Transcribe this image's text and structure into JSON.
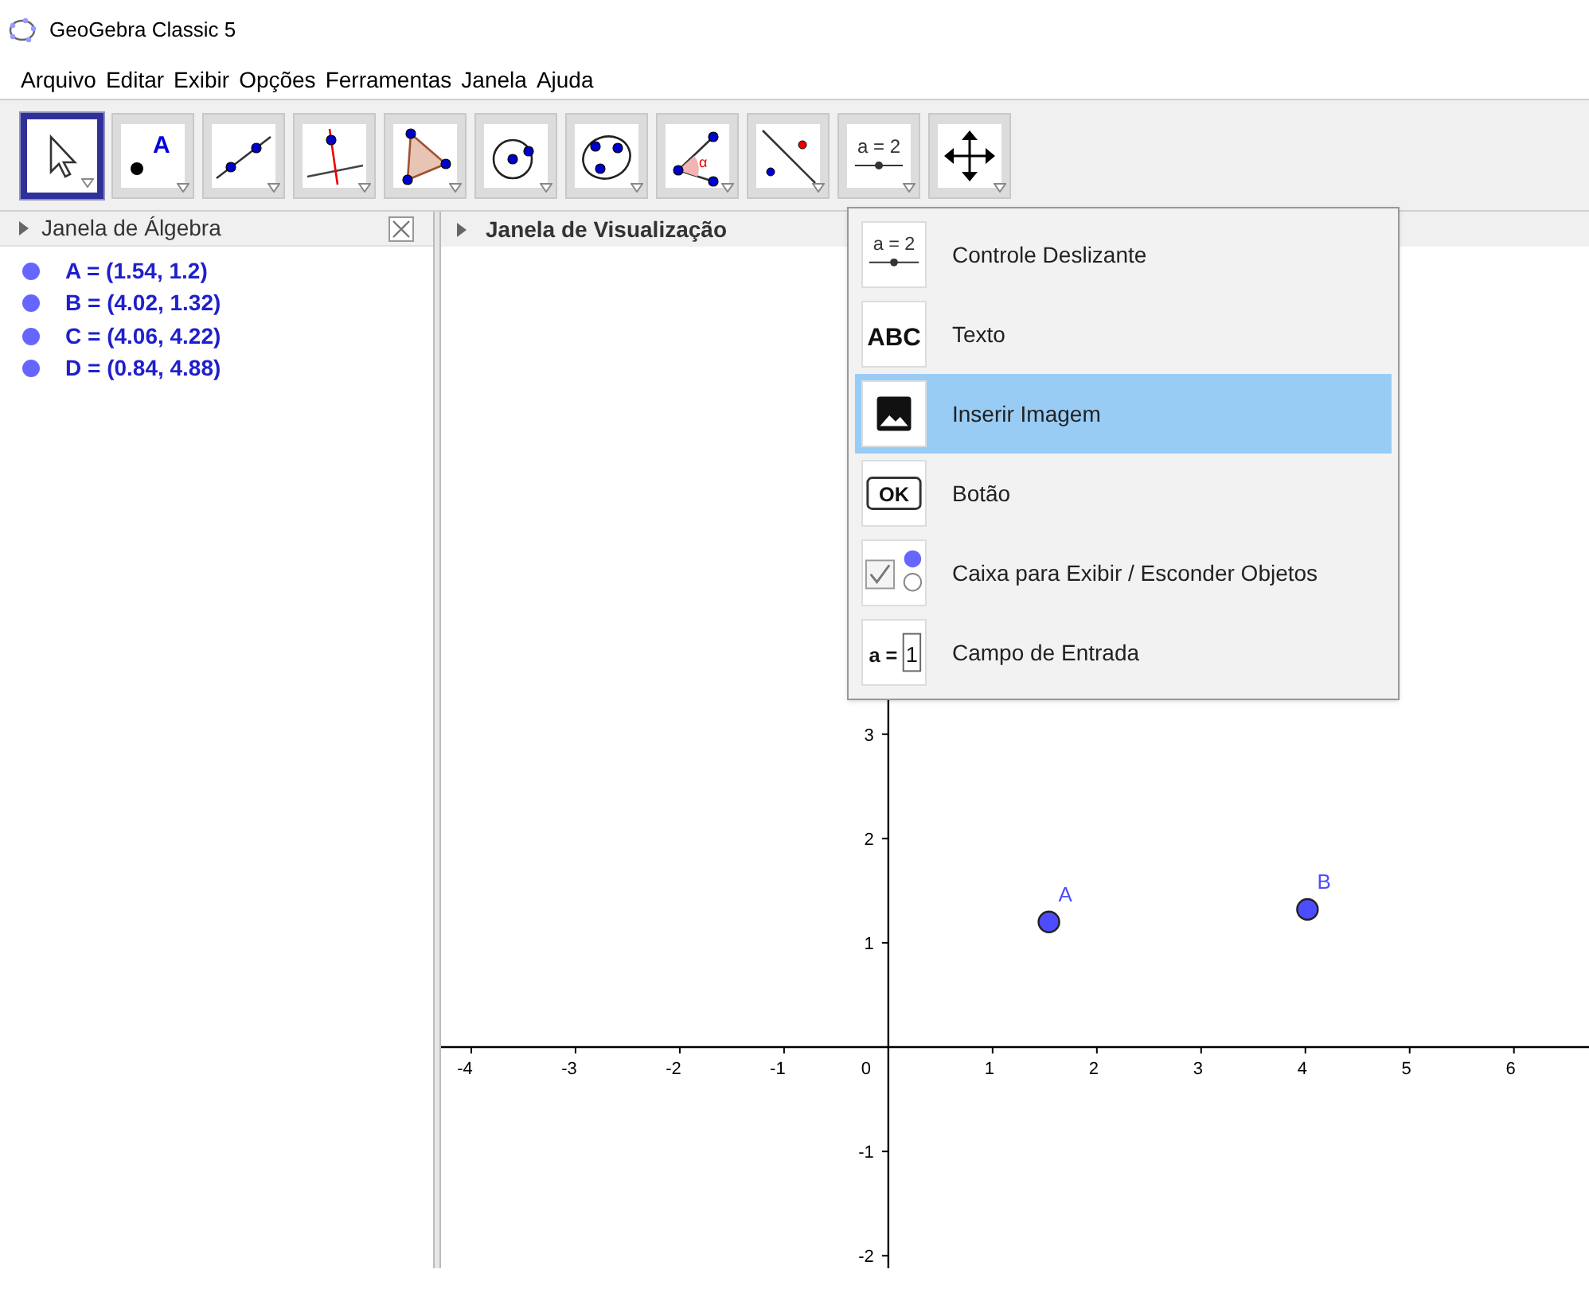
{
  "window": {
    "title": "GeoGebra Classic 5"
  },
  "menu_bar": [
    "Arquivo",
    "Editar",
    "Exibir",
    "Opções",
    "Ferramentas",
    "Janela",
    "Ajuda"
  ],
  "toolbar": [
    {
      "kind": "move",
      "selected": true
    },
    {
      "kind": "point",
      "selected": false,
      "icon_text": "A"
    },
    {
      "kind": "line",
      "selected": false
    },
    {
      "kind": "perpendicular",
      "selected": false
    },
    {
      "kind": "polygon",
      "selected": false
    },
    {
      "kind": "circle",
      "selected": false
    },
    {
      "kind": "conic",
      "selected": false
    },
    {
      "kind": "angle",
      "selected": false,
      "icon_text": "α"
    },
    {
      "kind": "reflect",
      "selected": false
    },
    {
      "kind": "slider",
      "selected": false,
      "icon_text": "a = 2"
    },
    {
      "kind": "move_view",
      "selected": false
    }
  ],
  "algebra_view": {
    "title": "Janela de Álgebra",
    "items": [
      "A = (1.54, 1.2)",
      "B = (4.02, 1.32)",
      "C = (4.06, 4.22)",
      "D = (0.84, 4.88)"
    ]
  },
  "graphics_view": {
    "title": "Janela de Visualização",
    "chart_data": {
      "type": "scatter",
      "x": [
        1.54,
        4.02
      ],
      "series": [
        {
          "color": "#4d4dff",
          "values": [
            1.2,
            1.32
          ]
        }
      ],
      "annotations": [
        "A",
        "B"
      ],
      "xlim": [
        -4.29,
        6.72
      ],
      "ylim": [
        -2.12,
        3.86
      ],
      "xticks": [
        -4,
        -3,
        -2,
        -1,
        1,
        2,
        3,
        4,
        5,
        6
      ],
      "yticks": [
        -2,
        -1,
        1,
        2,
        3
      ]
    },
    "origin_label": "0"
  },
  "tool_menu": [
    {
      "kind": "slider",
      "label": "Controle Deslizante",
      "icon_text": "a = 2",
      "selected": false
    },
    {
      "kind": "text",
      "label": "Texto",
      "icon_text": "ABC",
      "selected": false
    },
    {
      "kind": "image",
      "label": "Inserir Imagem",
      "selected": true
    },
    {
      "kind": "button",
      "label": "Botão",
      "icon_text": "OK",
      "selected": false
    },
    {
      "kind": "checkbox",
      "label": "Caixa para Exibir / Esconder Objetos",
      "selected": false
    },
    {
      "kind": "input",
      "label": "Campo de Entrada",
      "icon_text": "a =",
      "icon_box": "1",
      "selected": false
    }
  ]
}
